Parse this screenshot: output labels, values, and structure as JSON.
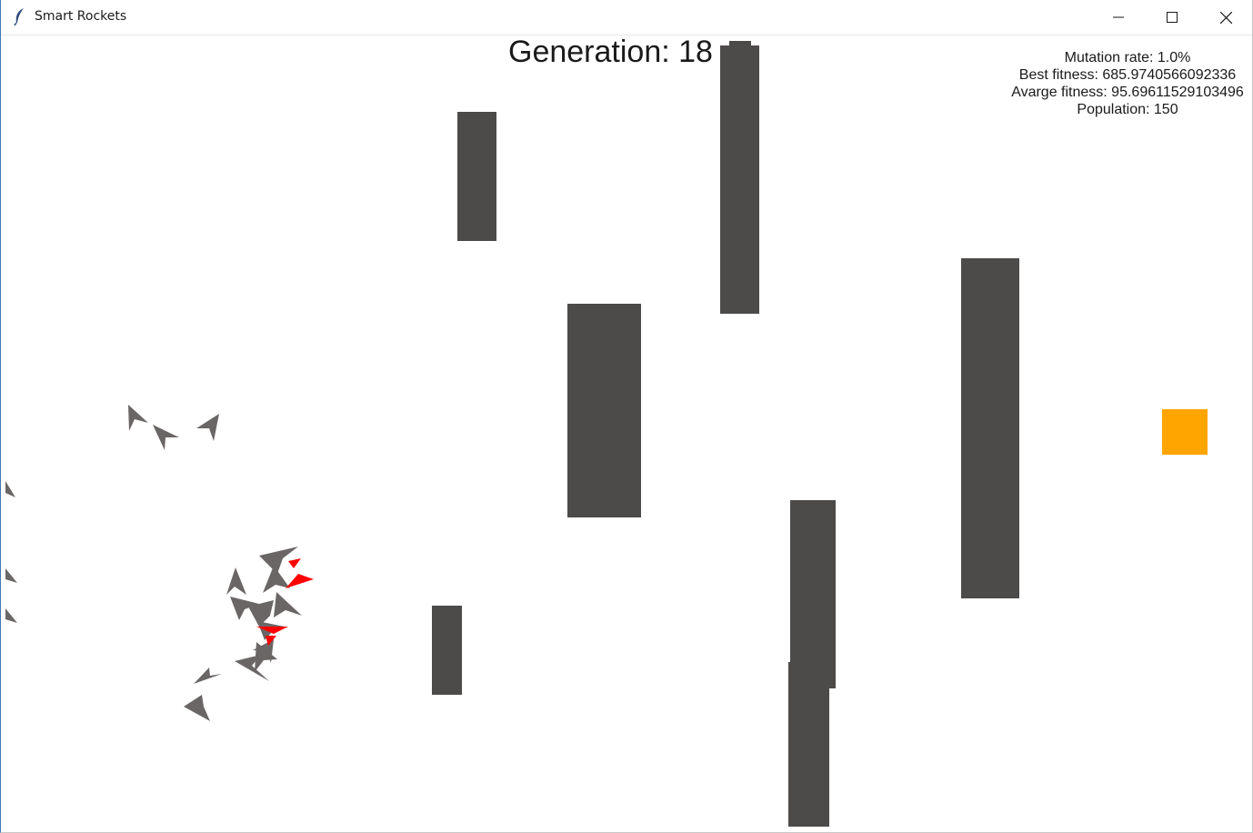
{
  "window": {
    "title": "Smart Rockets",
    "controls": {
      "minimize_icon": "minimize-icon",
      "maximize_icon": "maximize-icon",
      "close_icon": "close-icon"
    }
  },
  "hud": {
    "generation": "Generation: 18",
    "mutation_rate": "Mutation rate: 1.0%",
    "best_fitness": "Best fitness: 685.9740566092336",
    "average_fitness": "Avarge fitness: 95.69611529103496",
    "population": "Population: 150"
  },
  "colors": {
    "obstacle": "#4d4b4a",
    "target": "#ffa500",
    "rocket": "#6b6666",
    "rocket_best": "#ff0000",
    "background": "#ffffff"
  }
}
